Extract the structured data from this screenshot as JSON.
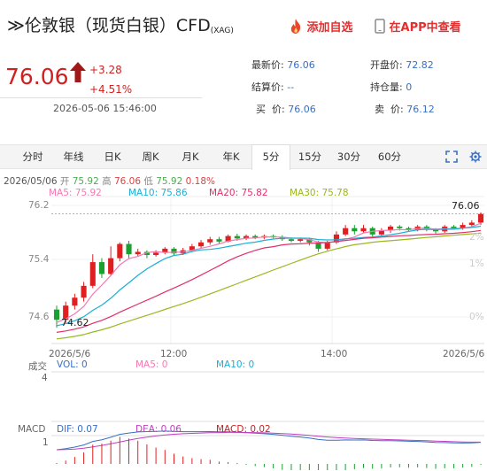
{
  "header": {
    "title": "≫伦敦银（现货白银）CFD",
    "title_sub": "(XAG)",
    "add_watch": "添加自选",
    "app_link": "在APP中查看"
  },
  "quote": {
    "price": "76.06",
    "change": "+3.28",
    "change_pct": "+4.51%",
    "time": "2026-05-06 15:46:00"
  },
  "fields": [
    {
      "label": "最新价:",
      "value": "76.06"
    },
    {
      "label": "开盘价:",
      "value": "72.82"
    },
    {
      "label": "结算价:",
      "value": "--"
    },
    {
      "label": "持仓量:",
      "value": "0"
    },
    {
      "label": "买  价:",
      "value": "76.06"
    },
    {
      "label": "卖  价:",
      "value": "76.12"
    }
  ],
  "tabs": [
    "分时",
    "年线",
    "日K",
    "周K",
    "月K",
    "年K",
    "5分",
    "15分",
    "30分",
    "60分"
  ],
  "active_tab": "5分",
  "ohlc": {
    "date": "2026/05/06",
    "open_label": "开",
    "open": "75.92",
    "high_label": "高",
    "high": "76.06",
    "low_label": "低",
    "low": "75.92",
    "change": "0.18%",
    "colors": {
      "date": "#555555",
      "open": "#4caf50",
      "high": "#e04040",
      "low": "#4caf50",
      "change": "#e04040"
    }
  },
  "ma_legend": [
    {
      "label": "MA5: 75.92",
      "color": "#f47ab0"
    },
    {
      "label": "MA10: 75.86",
      "color": "#1ab0d8"
    },
    {
      "label": "MA20: 75.82",
      "color": "#e0306a"
    },
    {
      "label": "MA30: 75.78",
      "color": "#9ab820"
    }
  ],
  "y_labels": [
    "76.2",
    "75.4",
    "74.6"
  ],
  "x_labels": [
    "2026/5/6",
    "12:00",
    "14:00",
    "2026/5/6"
  ],
  "max_label": "76.06",
  "min_label": "74.62",
  "pct_labels": [
    "2%",
    "1%",
    "0%"
  ],
  "volume": {
    "title": "成交",
    "vol": "VOL: 0",
    "ma5": "MA5: 0",
    "ma10": "MA10: 0",
    "scale": "4",
    "colors": {
      "vol": "#3a6fc4",
      "ma5": "#f47ab0",
      "ma10": "#1ab0d8"
    }
  },
  "macd": {
    "title": "MACD",
    "dif": "DIF: 0.07",
    "dea": "DEA: 0.06",
    "macd": "MACD: 0.02",
    "scale": "1",
    "colors": {
      "dif": "#3a6fc4",
      "dea": "#c040c0",
      "macd": "#d02020"
    }
  },
  "chart_data": {
    "type": "candlestick",
    "series": [
      {
        "name": "MA5",
        "color": "#f47ab0"
      },
      {
        "name": "MA10",
        "color": "#1ab0d8"
      },
      {
        "name": "MA20",
        "color": "#e0306a"
      },
      {
        "name": "MA30",
        "color": "#9ab820"
      }
    ],
    "ylim": [
      74.42,
      76.28
    ],
    "candles": [
      {
        "o": 74.85,
        "c": 74.72,
        "h": 74.9,
        "l": 74.62
      },
      {
        "o": 74.72,
        "c": 74.9,
        "h": 74.95,
        "l": 74.68
      },
      {
        "o": 74.9,
        "c": 75.0,
        "h": 75.05,
        "l": 74.85
      },
      {
        "o": 75.0,
        "c": 75.15,
        "h": 75.2,
        "l": 74.95
      },
      {
        "o": 75.15,
        "c": 75.45,
        "h": 75.55,
        "l": 75.12
      },
      {
        "o": 75.45,
        "c": 75.3,
        "h": 75.5,
        "l": 75.25
      },
      {
        "o": 75.3,
        "c": 75.5,
        "h": 75.65,
        "l": 75.28
      },
      {
        "o": 75.5,
        "c": 75.68,
        "h": 75.7,
        "l": 75.46
      },
      {
        "o": 75.68,
        "c": 75.55,
        "h": 75.72,
        "l": 75.5
      },
      {
        "o": 75.55,
        "c": 75.58,
        "h": 75.62,
        "l": 75.52
      },
      {
        "o": 75.58,
        "c": 75.54,
        "h": 75.6,
        "l": 75.5
      },
      {
        "o": 75.54,
        "c": 75.57,
        "h": 75.6,
        "l": 75.52
      },
      {
        "o": 75.57,
        "c": 75.62,
        "h": 75.64,
        "l": 75.55
      },
      {
        "o": 75.62,
        "c": 75.56,
        "h": 75.64,
        "l": 75.53
      },
      {
        "o": 75.56,
        "c": 75.6,
        "h": 75.63,
        "l": 75.54
      },
      {
        "o": 75.6,
        "c": 75.65,
        "h": 75.68,
        "l": 75.58
      },
      {
        "o": 75.65,
        "c": 75.7,
        "h": 75.73,
        "l": 75.63
      },
      {
        "o": 75.7,
        "c": 75.74,
        "h": 75.77,
        "l": 75.67
      },
      {
        "o": 75.74,
        "c": 75.71,
        "h": 75.77,
        "l": 75.68
      },
      {
        "o": 75.71,
        "c": 75.78,
        "h": 75.8,
        "l": 75.7
      },
      {
        "o": 75.78,
        "c": 75.75,
        "h": 75.81,
        "l": 75.72
      },
      {
        "o": 75.75,
        "c": 75.78,
        "h": 75.8,
        "l": 75.73
      },
      {
        "o": 75.78,
        "c": 75.76,
        "h": 75.8,
        "l": 75.74
      },
      {
        "o": 75.76,
        "c": 75.78,
        "h": 75.8,
        "l": 75.74
      },
      {
        "o": 75.78,
        "c": 75.77,
        "h": 75.8,
        "l": 75.75
      },
      {
        "o": 75.77,
        "c": 75.74,
        "h": 75.79,
        "l": 75.72
      },
      {
        "o": 75.74,
        "c": 75.72,
        "h": 75.76,
        "l": 75.7
      },
      {
        "o": 75.72,
        "c": 75.74,
        "h": 75.76,
        "l": 75.7
      },
      {
        "o": 75.74,
        "c": 75.7,
        "h": 75.76,
        "l": 75.66
      },
      {
        "o": 75.7,
        "c": 75.62,
        "h": 75.72,
        "l": 75.58
      },
      {
        "o": 75.62,
        "c": 75.7,
        "h": 75.72,
        "l": 75.6
      },
      {
        "o": 75.7,
        "c": 75.8,
        "h": 75.84,
        "l": 75.68
      },
      {
        "o": 75.8,
        "c": 75.88,
        "h": 75.92,
        "l": 75.78
      },
      {
        "o": 75.88,
        "c": 75.84,
        "h": 75.92,
        "l": 75.8
      },
      {
        "o": 75.84,
        "c": 75.88,
        "h": 75.92,
        "l": 75.82
      },
      {
        "o": 75.88,
        "c": 75.8,
        "h": 75.9,
        "l": 75.76
      },
      {
        "o": 75.8,
        "c": 75.85,
        "h": 75.88,
        "l": 75.78
      },
      {
        "o": 75.85,
        "c": 75.9,
        "h": 75.92,
        "l": 75.82
      },
      {
        "o": 75.9,
        "c": 75.88,
        "h": 75.92,
        "l": 75.85
      },
      {
        "o": 75.88,
        "c": 75.86,
        "h": 75.9,
        "l": 75.84
      },
      {
        "o": 75.86,
        "c": 75.9,
        "h": 75.92,
        "l": 75.84
      },
      {
        "o": 75.9,
        "c": 75.86,
        "h": 75.92,
        "l": 75.84
      },
      {
        "o": 75.86,
        "c": 75.84,
        "h": 75.88,
        "l": 75.8
      },
      {
        "o": 75.84,
        "c": 75.9,
        "h": 75.92,
        "l": 75.82
      },
      {
        "o": 75.9,
        "c": 75.88,
        "h": 75.92,
        "l": 75.86
      },
      {
        "o": 75.88,
        "c": 75.92,
        "h": 75.95,
        "l": 75.86
      },
      {
        "o": 75.92,
        "c": 75.95,
        "h": 75.98,
        "l": 75.9
      },
      {
        "o": 75.95,
        "c": 76.06,
        "h": 76.08,
        "l": 75.92
      }
    ]
  }
}
